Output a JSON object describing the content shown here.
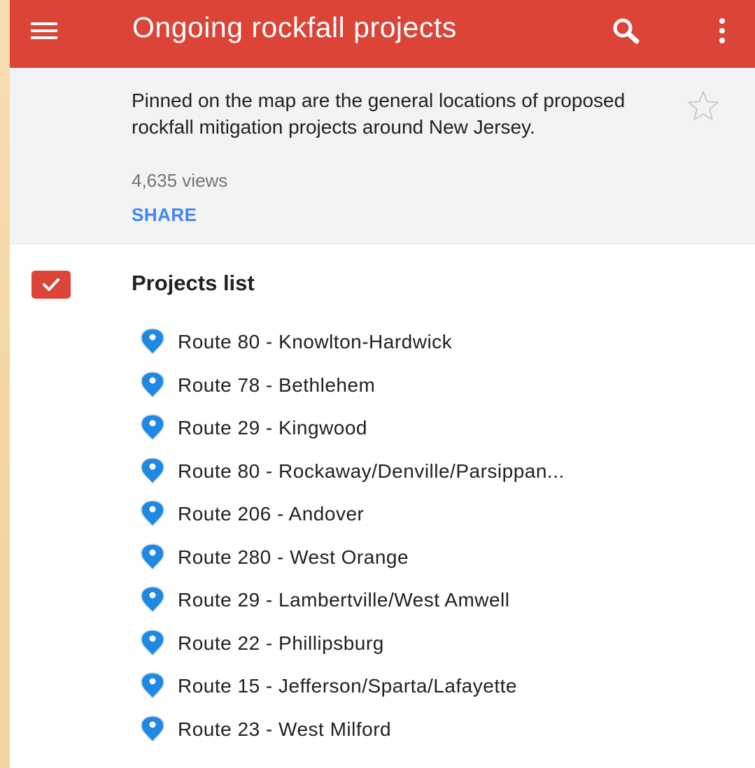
{
  "app_bar": {
    "menu_icon": "hamburger-menu-icon",
    "title": "Ongoing rockfall projects",
    "search_icon": "search-icon",
    "more_icon": "more-vertical-icon",
    "background_color": "#db4437"
  },
  "summary": {
    "description": "Pinned on the map are the general locations of proposed rockfall mitigation projects around New Jersey.",
    "views": "4,635 views",
    "share_label": "SHARE",
    "star_icon": "star-outline-icon"
  },
  "layer": {
    "checked": true,
    "checkbox_color": "#db4437",
    "title": "Projects list"
  },
  "projects": {
    "pin_color": "#1e88e5",
    "items": [
      {
        "label": "Route 80 - Knowlton-Hardwick"
      },
      {
        "label": "Route 78 - Bethlehem"
      },
      {
        "label": "Route 29 - Kingwood"
      },
      {
        "label": "Route 80 - Rockaway/Denville/Parsippan..."
      },
      {
        "label": "Route 206 - Andover"
      },
      {
        "label": "Route 280 - West Orange"
      },
      {
        "label": "Route 29 - Lambertville/West Amwell"
      },
      {
        "label": "Route 22 - Phillipsburg"
      },
      {
        "label": "Route 15 - Jefferson/Sparta/Lafayette"
      },
      {
        "label": "Route 23 - West Milford"
      }
    ]
  }
}
